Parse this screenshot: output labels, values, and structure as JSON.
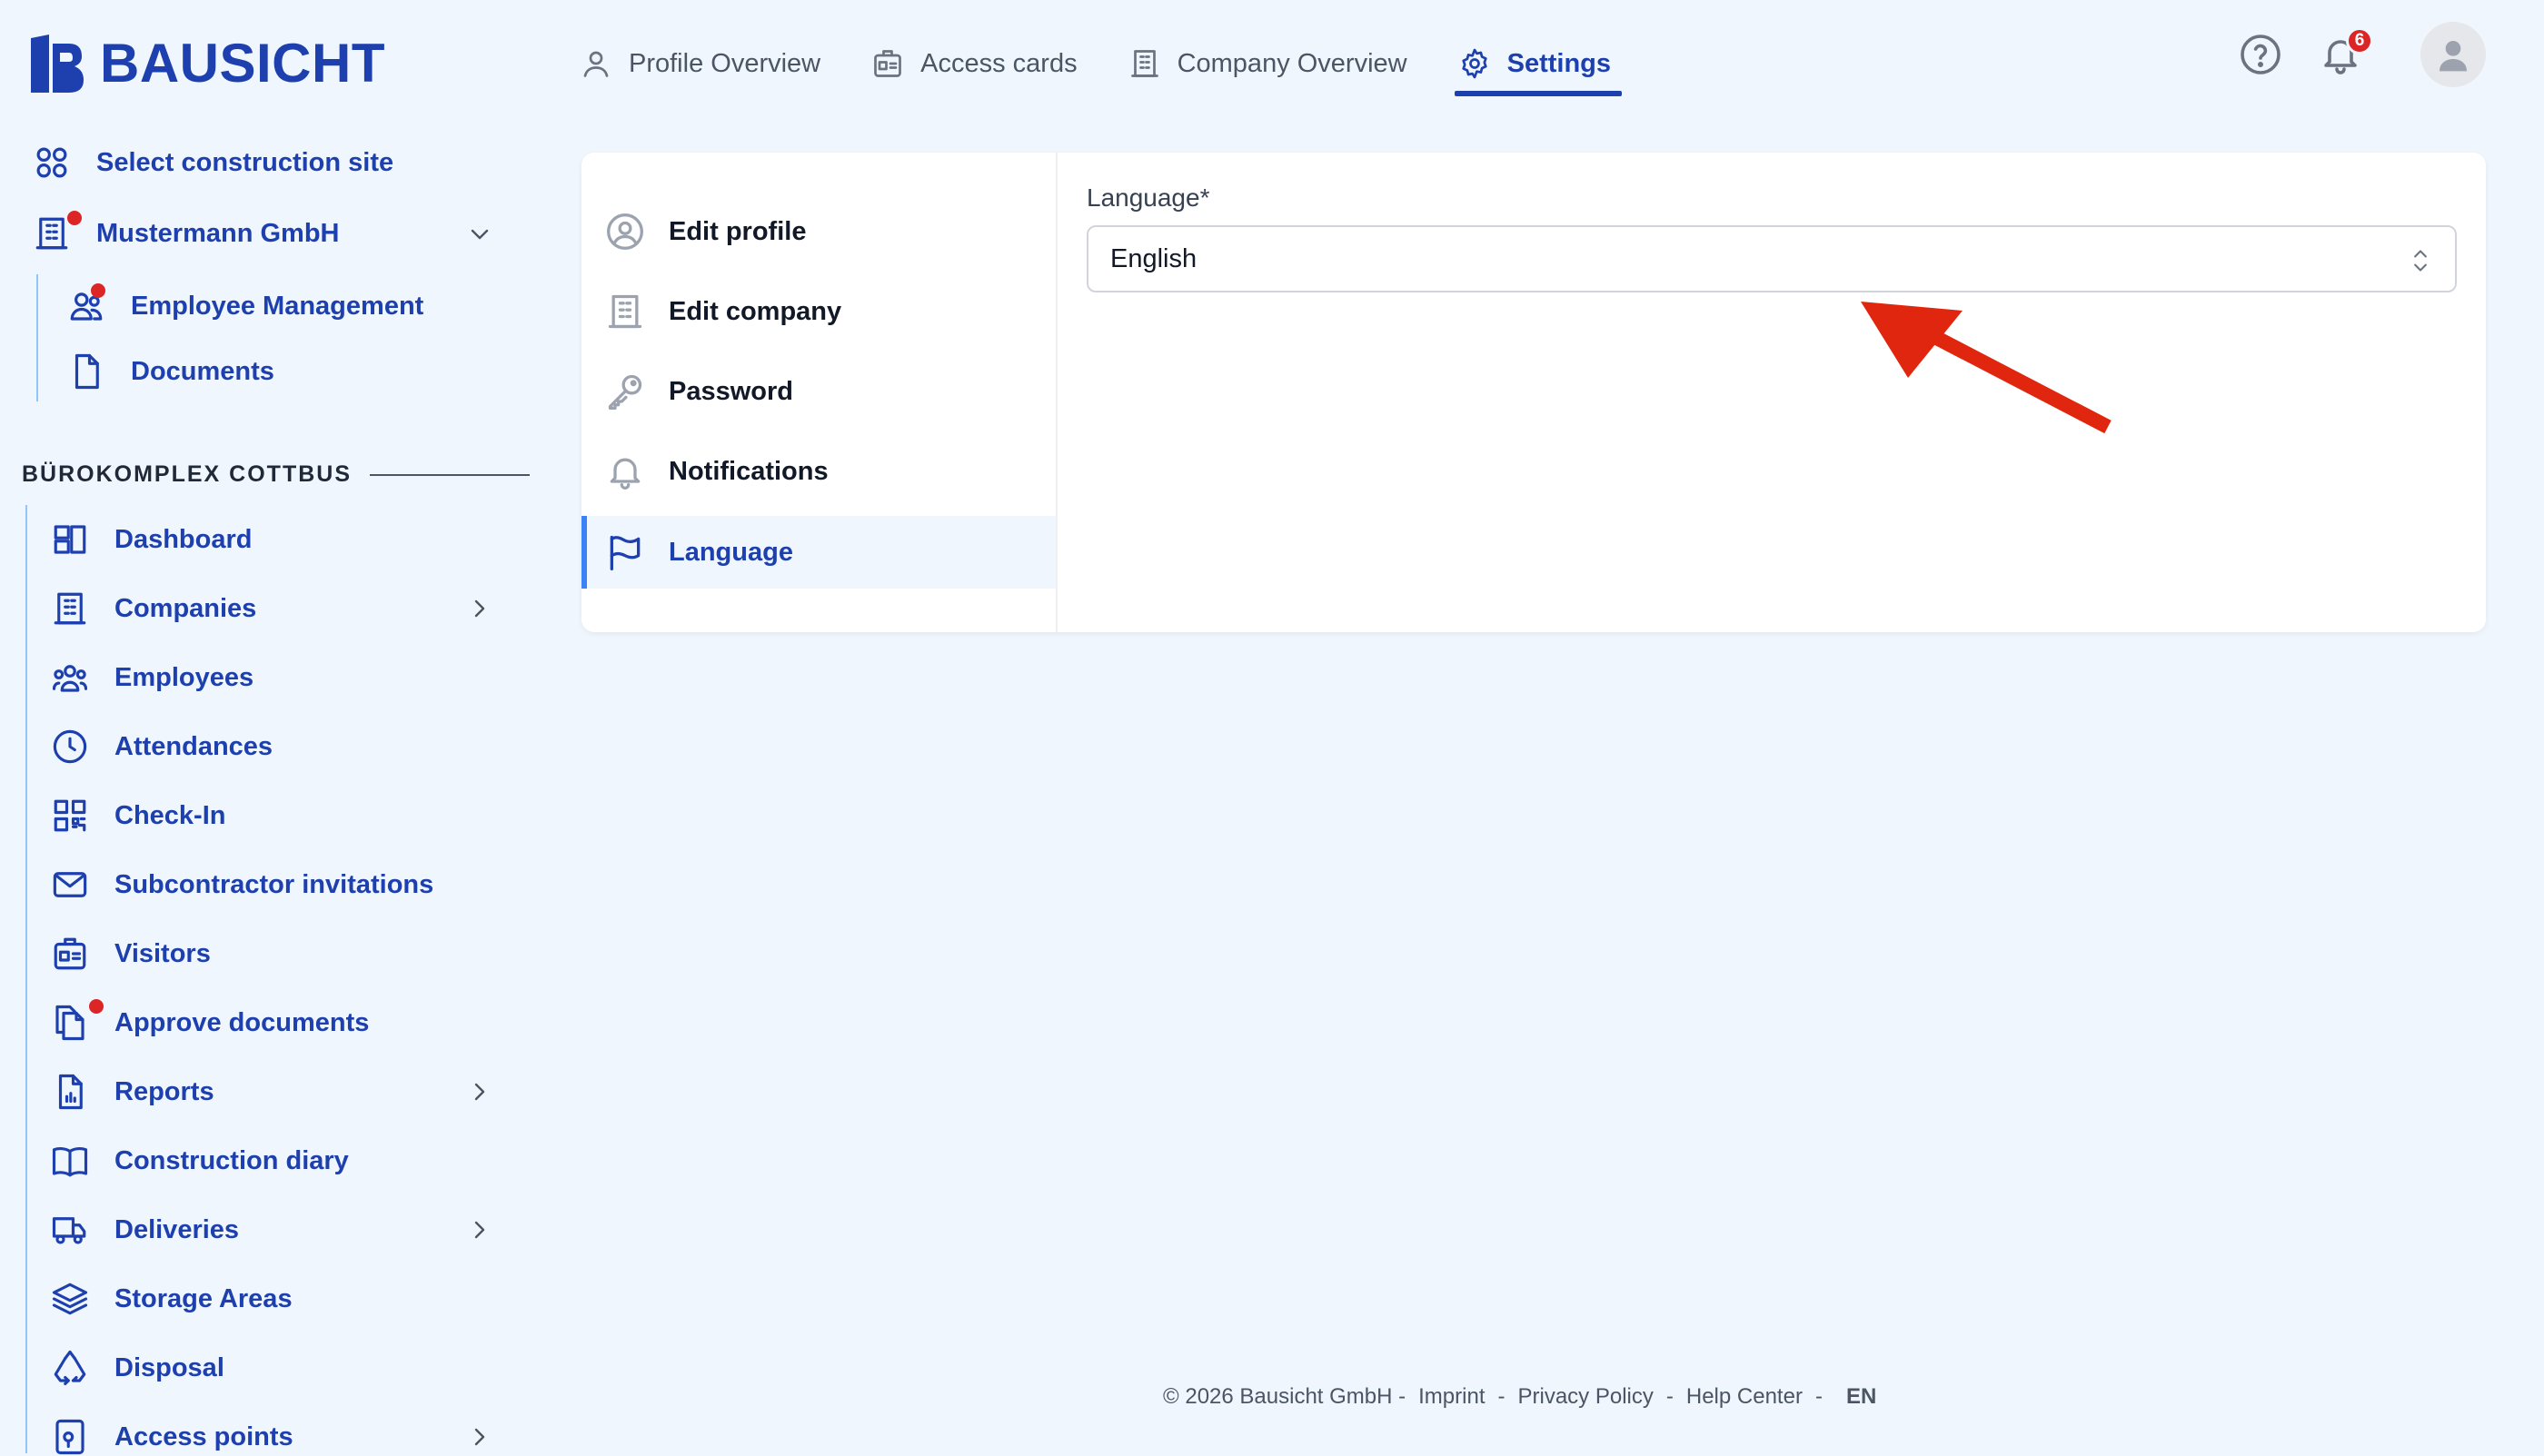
{
  "brand": {
    "name": "BAUSICHT"
  },
  "topnav": {
    "profile_overview": "Profile Overview",
    "access_cards": "Access cards",
    "company_overview": "Company Overview",
    "settings": "Settings"
  },
  "header": {
    "notification_count": "6"
  },
  "sidebar": {
    "select_site": "Select construction site",
    "company": "Mustermann GmbH",
    "employee_management": "Employee Management",
    "documents": "Documents",
    "section_title": "BÜROKOMPLEX COTTBUS",
    "items": [
      "Dashboard",
      "Companies",
      "Employees",
      "Attendances",
      "Check-In",
      "Subcontractor invitations",
      "Visitors",
      "Approve documents",
      "Reports",
      "Construction diary",
      "Deliveries",
      "Storage Areas",
      "Disposal",
      "Access points"
    ]
  },
  "settings": {
    "menu": [
      "Edit profile",
      "Edit company",
      "Password",
      "Notifications",
      "Language"
    ],
    "language_label": "Language*",
    "language_value": "English"
  },
  "footer": {
    "copyright": "© 2026 Bausicht GmbH -",
    "imprint": "Imprint",
    "sep1": "-",
    "privacy": "Privacy Policy",
    "sep2": "-",
    "help": "Help Center",
    "sep3": "-",
    "lang": "EN"
  },
  "colors": {
    "primary": "#1e40af",
    "accent": "#3b82f6",
    "background": "#eff6fd",
    "badge": "#dc2626",
    "annotation_arrow": "#e0260e"
  }
}
